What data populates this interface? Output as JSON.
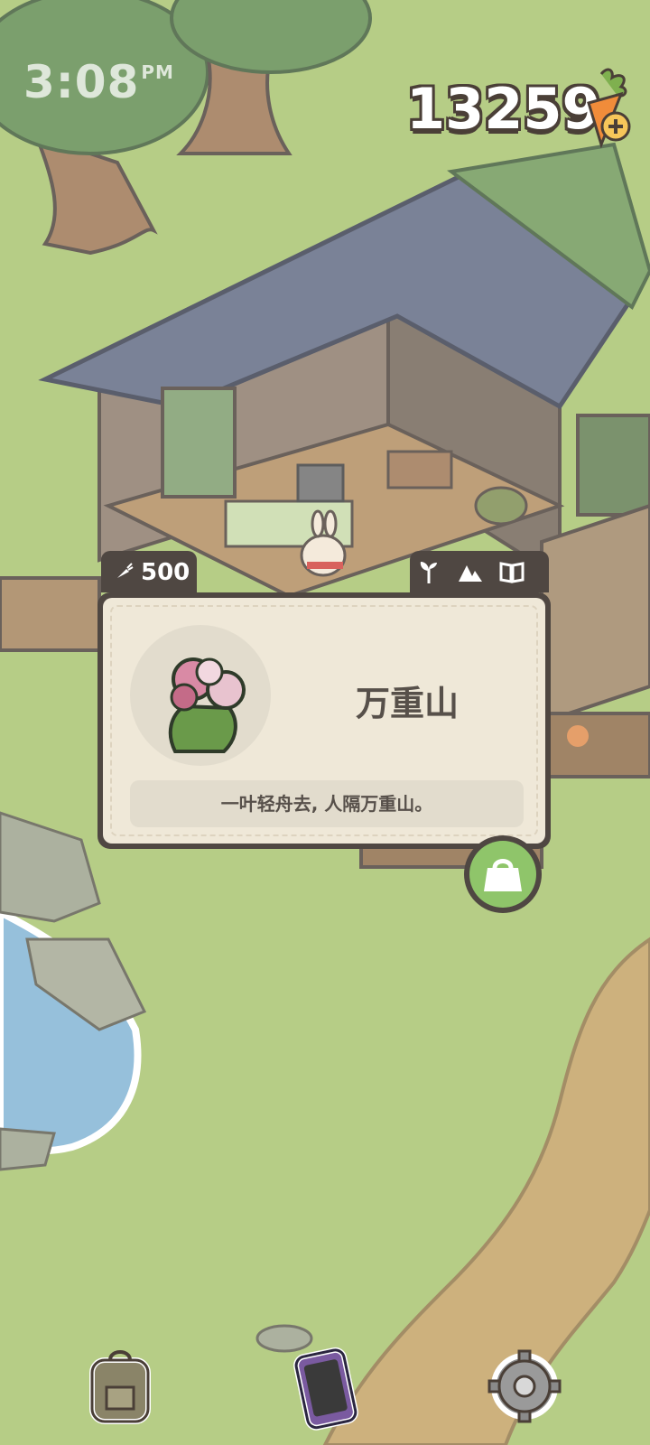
{
  "status_bar": {
    "time": "3:08",
    "ampm": "PM"
  },
  "currency": {
    "amount": "13259",
    "icon": "carrot-plus-icon"
  },
  "popup": {
    "price": "500",
    "price_icon": "carrot-icon",
    "item_name": "万重山",
    "description": "一叶轻舟去, 人隔万重山。",
    "tabs": [
      "sprout-icon",
      "mountain-icon",
      "book-icon"
    ],
    "action_icon": "bag-icon"
  },
  "bottom_bar": {
    "icons": [
      "backpack-icon",
      "phone-icon",
      "gear-icon"
    ]
  },
  "colors": {
    "grass": "#a6c26c",
    "panel_dark": "#4f4742",
    "panel_light": "#efe8d8",
    "accent_green": "#8fc56a",
    "path": "#c2a061",
    "water": "#7fb2d4"
  }
}
